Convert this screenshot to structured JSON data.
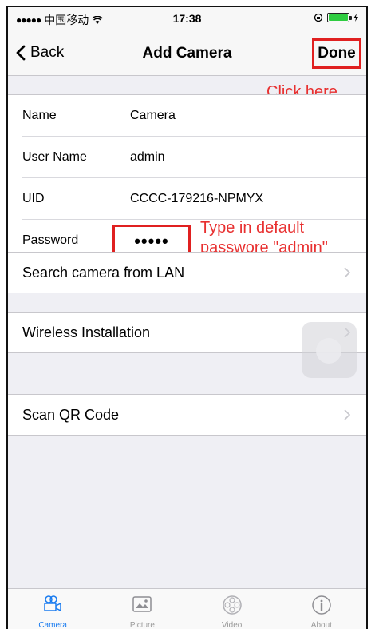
{
  "status_bar": {
    "carrier": "中国移动",
    "time": "17:38"
  },
  "nav": {
    "back_label": "Back",
    "title": "Add Camera",
    "done_label": "Done"
  },
  "annotations": {
    "click_here": "Click here",
    "type_default_line1": "Type in default",
    "type_default_line2": "passwore \"admin\""
  },
  "form": {
    "name_label": "Name",
    "name_value": "Camera",
    "username_label": "User Name",
    "username_value": "admin",
    "uid_label": "UID",
    "uid_value": "CCCC-179216-NPMYX",
    "password_label": "Password",
    "password_value": "•••••"
  },
  "menu": {
    "search_lan": "Search camera from LAN",
    "wireless": "Wireless Installation",
    "scan_qr": "Scan QR Code"
  },
  "tabs": [
    {
      "label": "Camera",
      "icon": "camera-icon",
      "active": true
    },
    {
      "label": "Picture",
      "icon": "picture-icon",
      "active": false
    },
    {
      "label": "Video",
      "icon": "video-icon",
      "active": false
    },
    {
      "label": "About",
      "icon": "info-icon",
      "active": false
    }
  ],
  "colors": {
    "accent": "#1a7cf0",
    "annotation": "#e02020",
    "background": "#efeff4"
  }
}
